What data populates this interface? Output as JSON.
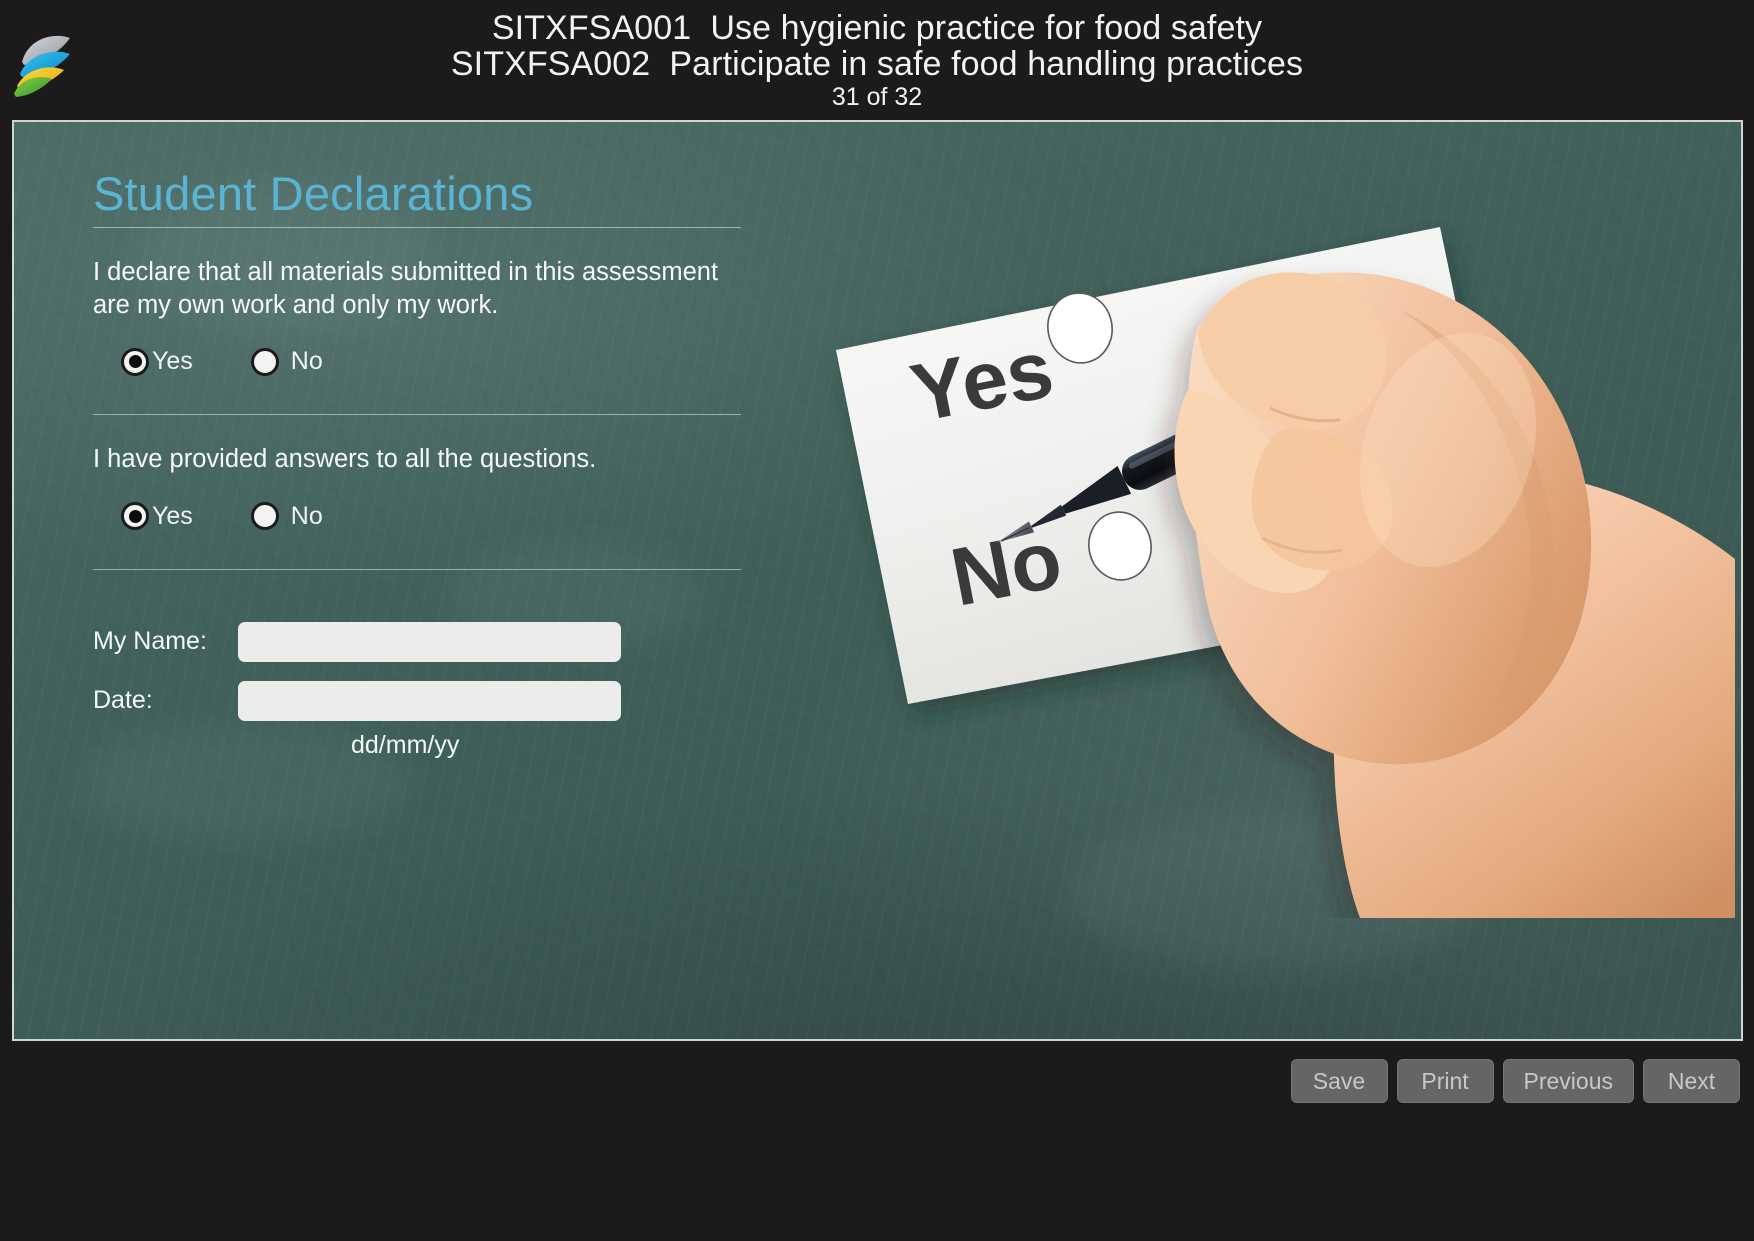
{
  "header": {
    "logo_icon": "leaf-feather-logo",
    "line1": "SITXFSA001  Use hygienic practice for food safety",
    "line2": "SITXFSA002  Participate in safe food handling practices",
    "page_counter": "31 of 32"
  },
  "content": {
    "section_title": "Student Declarations",
    "questions": [
      {
        "text": "I declare that all materials submitted in this assessment are my own work and only my work.",
        "yes_label": "Yes",
        "no_label": "No",
        "selected": "Yes"
      },
      {
        "text": "I have provided answers to all the questions.",
        "yes_label": "Yes",
        "no_label": "No",
        "selected": "Yes"
      }
    ],
    "fields": {
      "name_label": "My Name:",
      "name_value": "",
      "name_placeholder": "",
      "date_label": "Date:",
      "date_value": "",
      "date_placeholder": "",
      "date_hint": "dd/mm/yy"
    },
    "illustration": {
      "name": "hand-with-pen-marking-yes-no-form",
      "paper_yes_label": "Yes",
      "paper_no_label": "No"
    }
  },
  "footer": {
    "buttons": [
      {
        "label": "Save",
        "name": "save-button"
      },
      {
        "label": "Print",
        "name": "print-button"
      },
      {
        "label": "Previous",
        "name": "previous-button"
      },
      {
        "label": "Next",
        "name": "next-button"
      }
    ]
  },
  "colors": {
    "accent_heading": "#5ab4d4",
    "board_green": "#44635d",
    "chrome_dark": "#1c1a1a",
    "button_gray": "#656565"
  }
}
